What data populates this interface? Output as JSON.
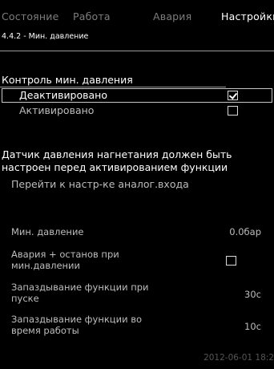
{
  "tabs": [
    {
      "label": "Состояние"
    },
    {
      "label": "Работа"
    },
    {
      "label": "Авария"
    },
    {
      "label": "Настройки"
    }
  ],
  "breadcrumb": "4.4.2 - Мин. давление",
  "section_title": "Контроль мин. давления",
  "options": [
    {
      "label": "Деактивировано",
      "checked": true
    },
    {
      "label": "Активировано",
      "checked": false
    }
  ],
  "notice": "Датчик давления нагнетания должен быть настроен перед активированием функции",
  "config_link": "Перейти к настр-ке аналог.входа",
  "params": {
    "min_pressure": {
      "label": "Мин. давление",
      "value": "0.0бар"
    },
    "alarm_stop": {
      "label": "Авария + останов при мин.давлении",
      "checked": false
    },
    "delay_start": {
      "label": "Запаздывание функции при пуске",
      "value": "30с"
    },
    "delay_run": {
      "label": "Запаздывание функции во время работы",
      "value": "10с"
    }
  },
  "footer_timestamp": "2012-06-01 18:2"
}
